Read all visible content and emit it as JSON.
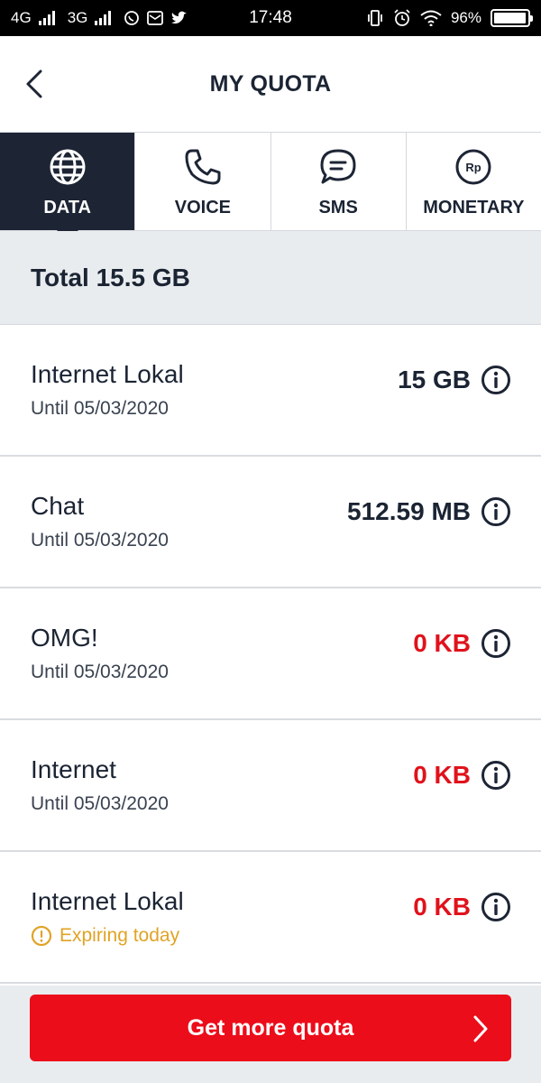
{
  "status_bar": {
    "network1": "4G",
    "network2": "3G",
    "time": "17:48",
    "battery": "96%",
    "battery_level": 0.96
  },
  "header": {
    "title": "MY QUOTA",
    "back_icon": "chevron-left-icon"
  },
  "tabs": [
    {
      "label": "DATA",
      "icon": "globe-icon",
      "active": true
    },
    {
      "label": "VOICE",
      "icon": "phone-icon",
      "active": false
    },
    {
      "label": "SMS",
      "icon": "chat-bubble-icon",
      "active": false
    },
    {
      "label": "MONETARY",
      "icon": "rupiah-icon",
      "active": false,
      "icon_text": "Rp"
    }
  ],
  "total": "Total 15.5 GB",
  "quotas": [
    {
      "name": "Internet Lokal",
      "sub": "Until 05/03/2020",
      "amount": "15 GB",
      "zero": false
    },
    {
      "name": "Chat",
      "sub": "Until 05/03/2020",
      "amount": "512.59 MB",
      "zero": false
    },
    {
      "name": "OMG!",
      "sub": "Until 05/03/2020",
      "amount": "0 KB",
      "zero": true
    },
    {
      "name": "Internet",
      "sub": "Until 05/03/2020",
      "amount": "0 KB",
      "zero": true
    },
    {
      "name": "Internet Lokal",
      "sub": "Expiring today",
      "amount": "0 KB",
      "zero": true,
      "warning": true
    }
  ],
  "cta": {
    "label": "Get more quota"
  },
  "colors": {
    "accent_red": "#ec0d1a",
    "navy": "#1d2535",
    "warning": "#e0a326"
  }
}
